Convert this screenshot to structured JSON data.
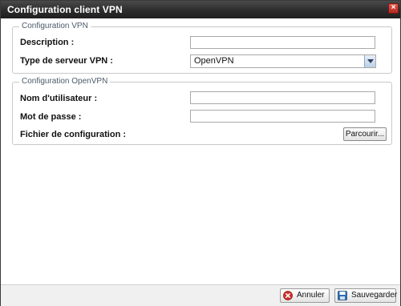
{
  "window": {
    "title": "Configuration client VPN",
    "close_symbol": "×"
  },
  "vpn_group": {
    "legend": "Configuration VPN",
    "description_label": "Description :",
    "description_value": "",
    "server_type_label": "Type de serveur VPN :",
    "server_type_value": "OpenVPN"
  },
  "openvpn_group": {
    "legend": "Configuration OpenVPN",
    "username_label": "Nom d'utilisateur :",
    "username_value": "",
    "password_label": "Mot de passe :",
    "password_value": "",
    "config_file_label": "Fichier de configuration :",
    "browse_label": "Parcourir..."
  },
  "footer": {
    "cancel_label": "Annuler",
    "save_label": "Sauvegarder"
  },
  "colors": {
    "titlebar": "#2c2c2c",
    "close_button": "#c8382d",
    "cancel_icon": "#d2302a",
    "save_icon": "#2f6fb5"
  },
  "icons": {
    "close": "close-icon",
    "dropdown": "chevron-down-icon",
    "cancel": "cancel-icon",
    "save": "floppy-disk-icon"
  }
}
